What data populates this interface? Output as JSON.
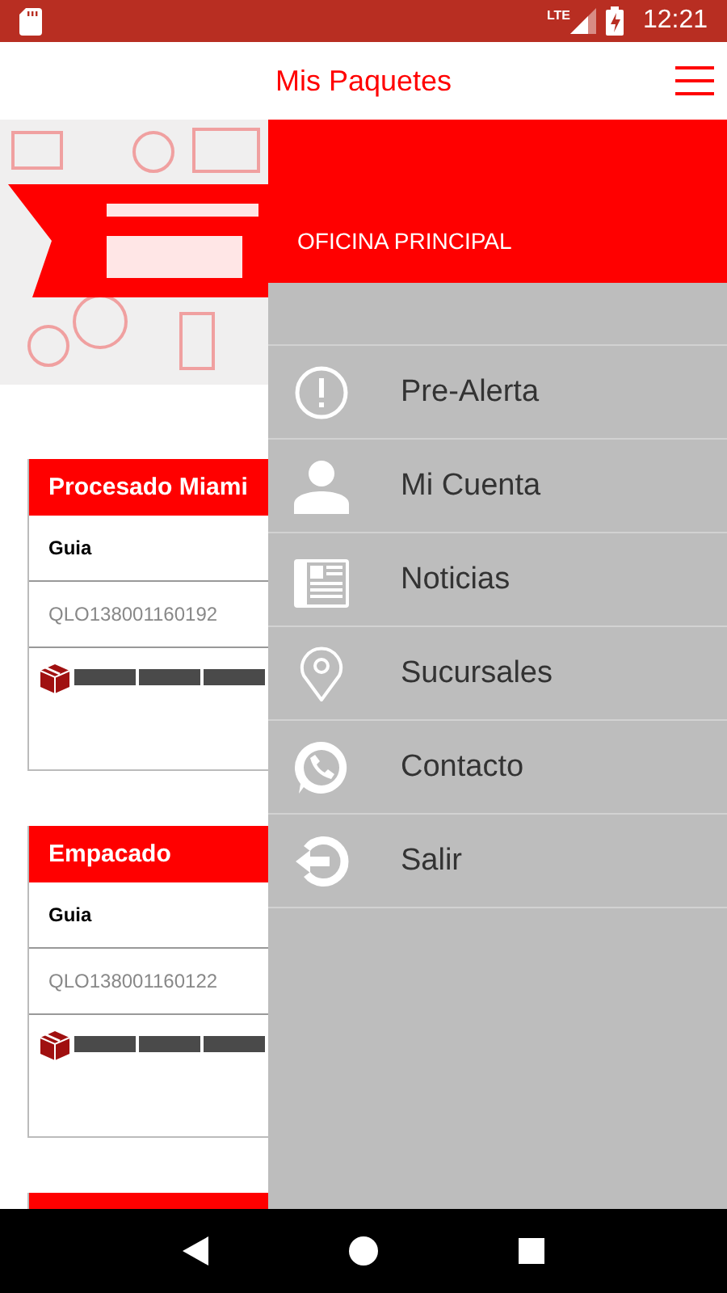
{
  "status_bar": {
    "network": "LTE",
    "time": "12:21"
  },
  "app_bar": {
    "title": "Mis Paquetes"
  },
  "packages": [
    {
      "status": "Procesado Miami",
      "guia_label": "Guia",
      "guia": "QLO138001160192"
    },
    {
      "status": "Empacado",
      "guia_label": "Guia",
      "guia": "QLO138001160122"
    }
  ],
  "next_card_partly_hidden": true,
  "drawer": {
    "office": "OFICINA PRINCIPAL",
    "items": [
      {
        "kind": "alert",
        "label": "Pre-Alerta"
      },
      {
        "kind": "account",
        "label": "Mi Cuenta"
      },
      {
        "kind": "news",
        "label": "Noticias"
      },
      {
        "kind": "branches",
        "label": "Sucursales"
      },
      {
        "kind": "contact",
        "label": "Contacto"
      },
      {
        "kind": "logout",
        "label": "Salir"
      }
    ]
  }
}
